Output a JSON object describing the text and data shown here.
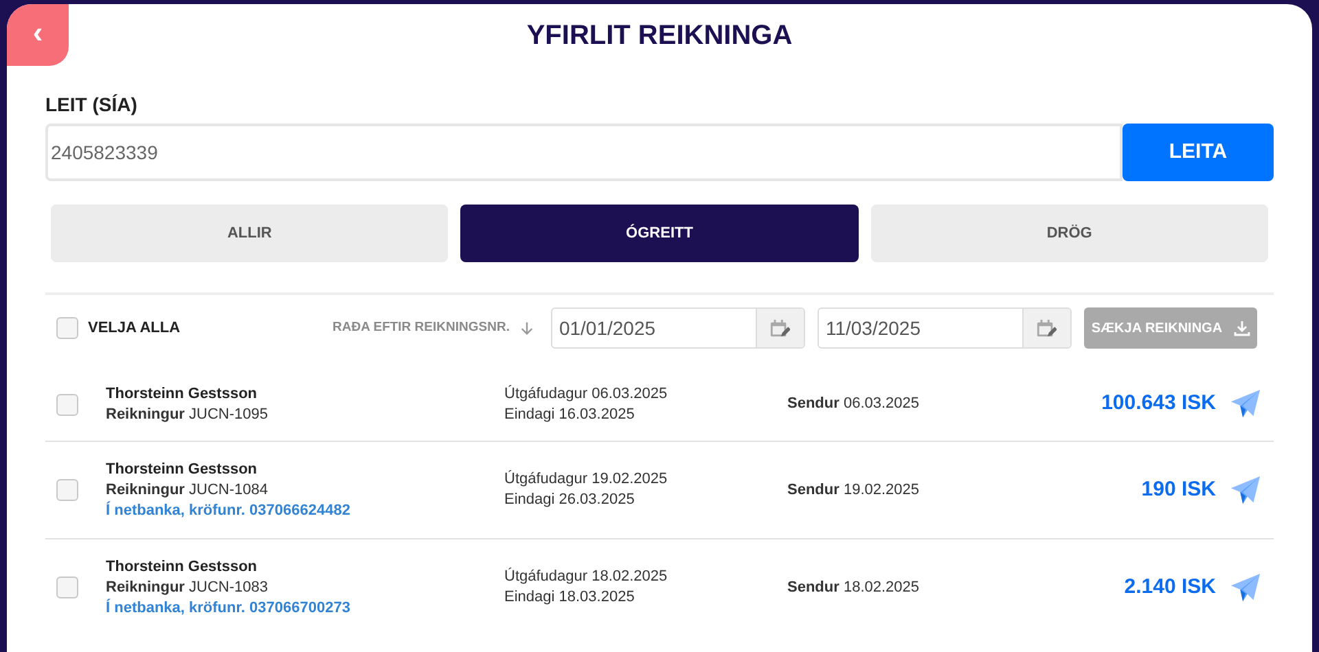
{
  "back_button": {
    "label": "‹"
  },
  "title": "YFIRLIT REIKNINGA",
  "search": {
    "label": "LEIT (SÍA)",
    "value": "2405823339",
    "button": "LEITA"
  },
  "tabs": [
    {
      "label": "ALLIR",
      "selected": false
    },
    {
      "label": "ÓGREITT",
      "selected": true
    },
    {
      "label": "DRÖG",
      "selected": false
    }
  ],
  "toolbar": {
    "select_all": {
      "label": "VELJA ALLA",
      "checked": false
    },
    "sort": "RAÐA EFTIR REIKNINGSNR.",
    "date_from": "01/01/2025",
    "date_to": "11/03/2025",
    "download": {
      "label": "SÆKJA REIKNINGA",
      "disabled": true
    }
  },
  "invoices": [
    {
      "checked": false,
      "name": "Thorsteinn Gestsson",
      "invoice": "**Reikningur** JUCN-1095",
      "issued": "Útgáfudagur 06.03.2025",
      "due": "Eindagi 16.03.2025",
      "status": "**Sendur** 06.03.2025",
      "amount": "100.643 ISK"
    },
    {
      "checked": false,
      "name": "Thorsteinn Gestsson",
      "invoice": "**Reikningur** JUCN-1084",
      "bank_link": "Í netbanka, kröfunr. 037066624482",
      "issued": "Útgáfudagur 19.02.2025",
      "due": "Eindagi 26.03.2025",
      "status": "**Sendur** 19.02.2025",
      "amount": "190 ISK"
    },
    {
      "checked": false,
      "name": "Thorsteinn Gestsson",
      "invoice": "**Reikningur** JUCN-1083",
      "bank_link": "Í netbanka, kröfunr. 037066700273",
      "issued": "Útgáfudagur 18.02.2025",
      "due": "Eindagi 18.03.2025",
      "status": "**Sendur** 18.02.2025",
      "amount": "2.140 ISK"
    }
  ]
}
